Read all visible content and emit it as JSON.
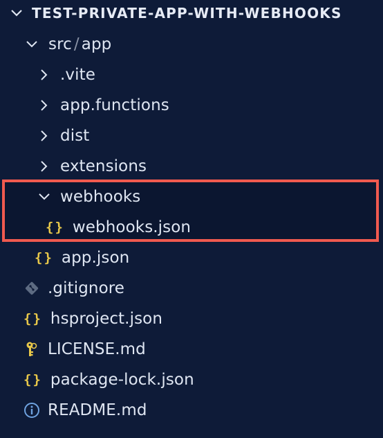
{
  "explorer": {
    "root_label": "TEST-PRIVATE-APP-WITH-WEBHOOKS",
    "src_folder": "src",
    "app_folder": "app",
    "path_separator": "/",
    "items": {
      "vite": ".vite",
      "app_functions": "app.functions",
      "dist": "dist",
      "extensions": "extensions",
      "webhooks": "webhooks",
      "webhooks_json": "webhooks.json",
      "app_json": "app.json",
      "gitignore": ".gitignore",
      "hsproject_json": "hsproject.json",
      "license": "LICENSE.md",
      "package_lock": "package-lock.json",
      "readme": "README.md"
    },
    "json_icon_glyph": "{}",
    "colors": {
      "background": "#0e1b38",
      "highlight_border": "#f05a4f",
      "json_icon": "#e8c84a",
      "text": "#dfe6f2"
    }
  }
}
